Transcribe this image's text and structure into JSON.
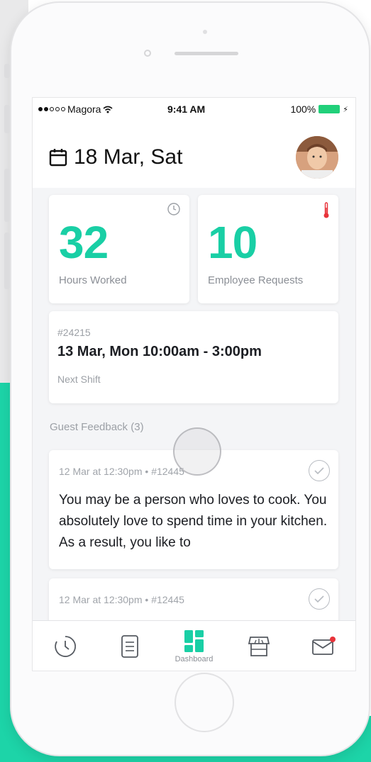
{
  "status_bar": {
    "carrier": "Magora",
    "time": "9:41 AM",
    "battery": "100%"
  },
  "header": {
    "date": "18 Mar, Sat"
  },
  "stats": [
    {
      "value": "32",
      "label": "Hours Worked",
      "icon": "clock-icon"
    },
    {
      "value": "10",
      "label": "Employee Requests",
      "icon": "thermometer-icon"
    }
  ],
  "next_shift": {
    "id": "#24215",
    "time": "13 Mar, Mon 10:00am - 3:00pm",
    "label": "Next Shift"
  },
  "feedback": {
    "title": "Guest Feedback (3)",
    "items": [
      {
        "meta": "12 Mar at 12:30pm  • #12445",
        "text": "You may be a person who loves to cook. You absolutely love to spend time in your kitchen. As a result, you like to"
      },
      {
        "meta": "12 Mar at 12:30pm  • #12445",
        "text": ""
      }
    ]
  },
  "tabs": [
    {
      "icon": "clock-icon",
      "label": ""
    },
    {
      "icon": "list-icon",
      "label": ""
    },
    {
      "icon": "dashboard-icon",
      "label": "Dashboard"
    },
    {
      "icon": "store-icon",
      "label": ""
    },
    {
      "icon": "mail-icon",
      "label": ""
    }
  ],
  "colors": {
    "accent": "#19cfa5",
    "background_teal": "#1dd4a8",
    "notification": "#e8333a"
  }
}
